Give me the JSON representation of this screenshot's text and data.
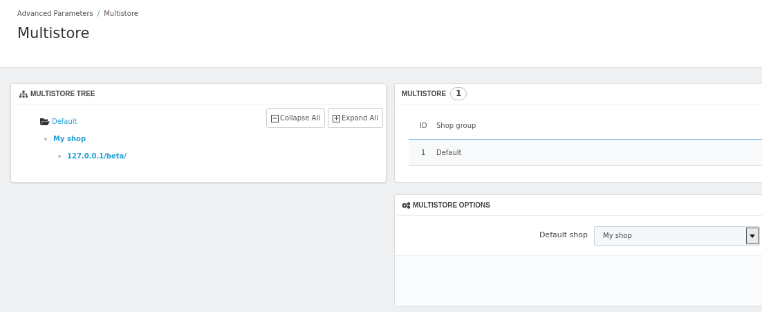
{
  "breadcrumb": {
    "items": [
      "Advanced Parameters",
      "Multistore"
    ],
    "separator": "/"
  },
  "page_title": "Multistore",
  "tree_panel": {
    "title": "MULTISTORE TREE",
    "buttons": [
      {
        "label": "Collapse All",
        "kind": "collapse"
      },
      {
        "label": "Expand All",
        "kind": "expand"
      }
    ],
    "tree": [
      {
        "label": "Default",
        "kind": "group",
        "children": [
          {
            "label": "My shop",
            "children": [
              {
                "label": "127.0.0.1/beta/"
              }
            ]
          }
        ]
      }
    ]
  },
  "list_panel": {
    "title": "MULTISTORE",
    "count": "1",
    "columns": [
      "ID",
      "Shop group"
    ],
    "rows": [
      [
        "1",
        "Default"
      ]
    ]
  },
  "options_panel": {
    "title": "MULTISTORE OPTIONS",
    "field_label": "Default shop",
    "field_value": "My shop"
  }
}
